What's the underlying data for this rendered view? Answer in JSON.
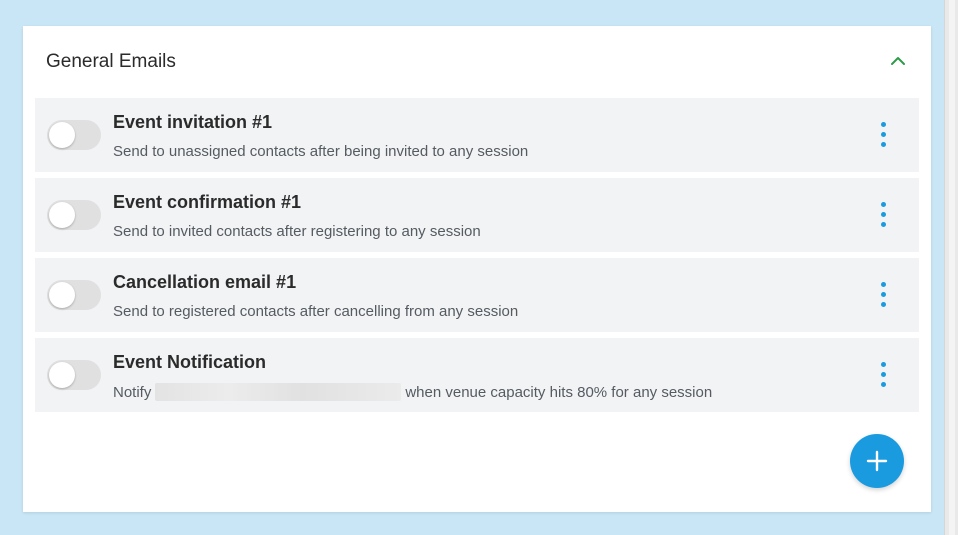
{
  "section": {
    "title": "General Emails",
    "collapse_icon": "chevron-up-icon",
    "accent": "#1a9be0",
    "chevron_color": "#2e9a4a"
  },
  "rows": [
    {
      "title": "Event invitation #1",
      "description": "Send to unassigned contacts after being invited to any session",
      "enabled": false
    },
    {
      "title": "Event confirmation #1",
      "description": "Send to invited contacts after registering to any session",
      "enabled": false
    },
    {
      "title": "Cancellation email #1",
      "description": "Send to registered contacts after cancelling from any session",
      "enabled": false
    },
    {
      "title": "Event Notification",
      "description_prefix": "Notify",
      "description_suffix": "when venue capacity hits 80% for any session",
      "enabled": false
    }
  ],
  "add_button": {
    "icon": "plus-icon"
  }
}
